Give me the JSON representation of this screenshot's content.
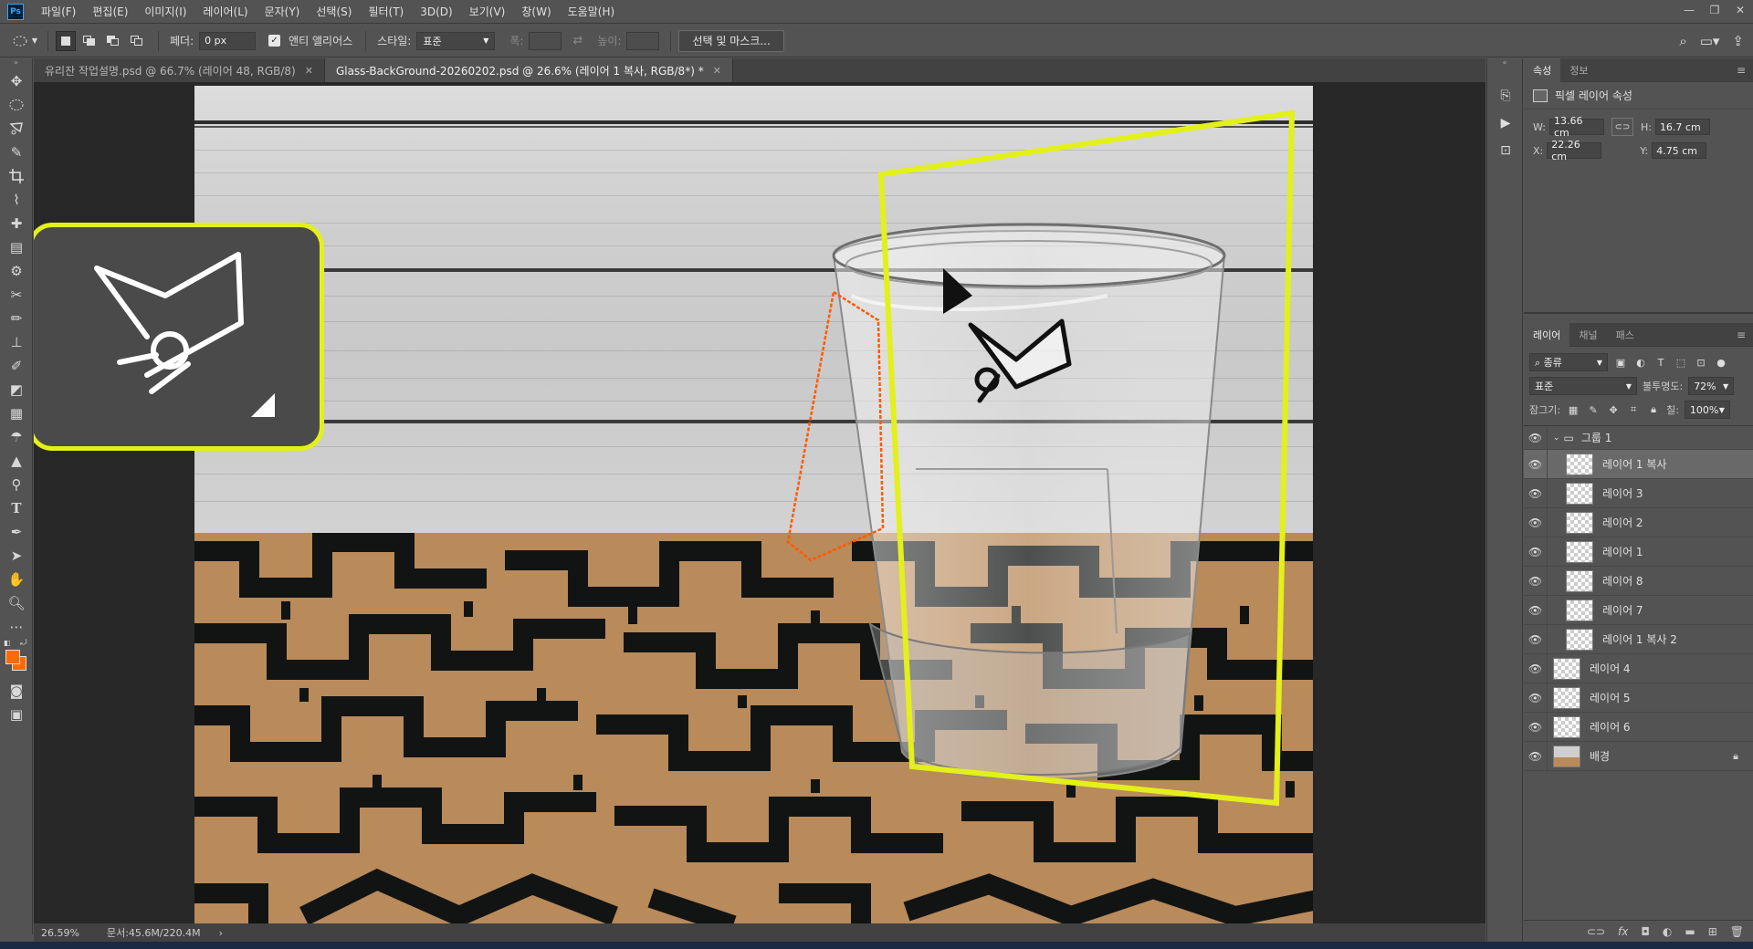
{
  "menu": {
    "logo": "Ps",
    "items": [
      "파일(F)",
      "편집(E)",
      "이미지(I)",
      "레이어(L)",
      "문자(Y)",
      "선택(S)",
      "필터(T)",
      "3D(D)",
      "보기(V)",
      "창(W)",
      "도움말(H)"
    ]
  },
  "options": {
    "feather_label": "페더:",
    "feather_value": "0 px",
    "antialias_label": "앤티 앨리어스",
    "style_label": "스타일:",
    "style_value": "표준",
    "width_label": "폭:",
    "height_label": "높이:",
    "select_mask_button": "선택 및 마스크..."
  },
  "tabs": [
    {
      "label": "유리잔 작업설명.psd @ 66.7% (레이어 48, RGB/8)",
      "active": false
    },
    {
      "label": "Glass-BackGround-20260202.psd @ 26.6% (레이어 1 복사, RGB/8*) *",
      "active": true
    }
  ],
  "status": {
    "zoom": "26.59%",
    "doc_info": "문서:45.6M/220.4M"
  },
  "colors": {
    "foreground": "#ff6a00",
    "background": "#ff6a00",
    "highlight": "#e3f01a",
    "selection": "#ff5a00"
  },
  "properties": {
    "tabs": [
      "속성",
      "정보"
    ],
    "title": "픽셀 레이어 속성",
    "w_label": "W:",
    "w_value": "13.66 cm",
    "h_label": "H:",
    "h_value": "16.7 cm",
    "x_label": "X:",
    "x_value": "22.26 cm",
    "y_label": "Y:",
    "y_value": "4.75 cm"
  },
  "layers_panel": {
    "tabs": [
      "레이어",
      "채널",
      "패스"
    ],
    "filter_kind": "종류",
    "blend_mode": "표준",
    "opacity_label": "불투명도:",
    "opacity_value": "72%",
    "lock_label": "잠그기:",
    "fill_label": "칠:",
    "fill_value": "100%",
    "group_name": "그룹 1",
    "layers": [
      {
        "name": "레이어 1 복사",
        "indent": true,
        "selected": true
      },
      {
        "name": "레이어 3",
        "indent": true,
        "selected": false
      },
      {
        "name": "레이어 2",
        "indent": true,
        "selected": false
      },
      {
        "name": "레이어 1",
        "indent": true,
        "selected": false
      },
      {
        "name": "레이어 8",
        "indent": true,
        "selected": false
      },
      {
        "name": "레이어 7",
        "indent": true,
        "selected": false
      },
      {
        "name": "레이어 1 복사 2",
        "indent": true,
        "selected": false
      },
      {
        "name": "레이어 4",
        "indent": false,
        "selected": false
      },
      {
        "name": "레이어 5",
        "indent": false,
        "selected": false
      },
      {
        "name": "레이어 6",
        "indent": false,
        "selected": false
      },
      {
        "name": "배경",
        "indent": false,
        "selected": false,
        "locked": true
      }
    ]
  }
}
